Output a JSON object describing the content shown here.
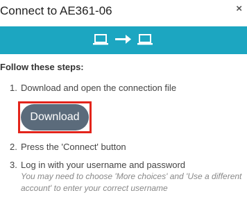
{
  "dialog": {
    "title": "Connect to AE361-06",
    "close_glyph": "×"
  },
  "banner": {
    "icons": [
      "laptop-icon",
      "arrow-right-icon",
      "laptop-icon"
    ],
    "color": "#1ca6c1"
  },
  "instructions": {
    "heading": "Follow these steps:",
    "steps": [
      {
        "number": "1.",
        "text": "Download and open the connection file"
      },
      {
        "number": "2.",
        "text": "Press the 'Connect' button"
      },
      {
        "number": "3.",
        "text": "Log in with your username and password"
      }
    ],
    "hint_lines": [
      "You may need to choose 'More choices' and 'Use a different",
      "account' to enter your correct username"
    ]
  },
  "download": {
    "label": "Download",
    "button_color": "#5b6b7b",
    "highlight_color": "#e3241b"
  }
}
